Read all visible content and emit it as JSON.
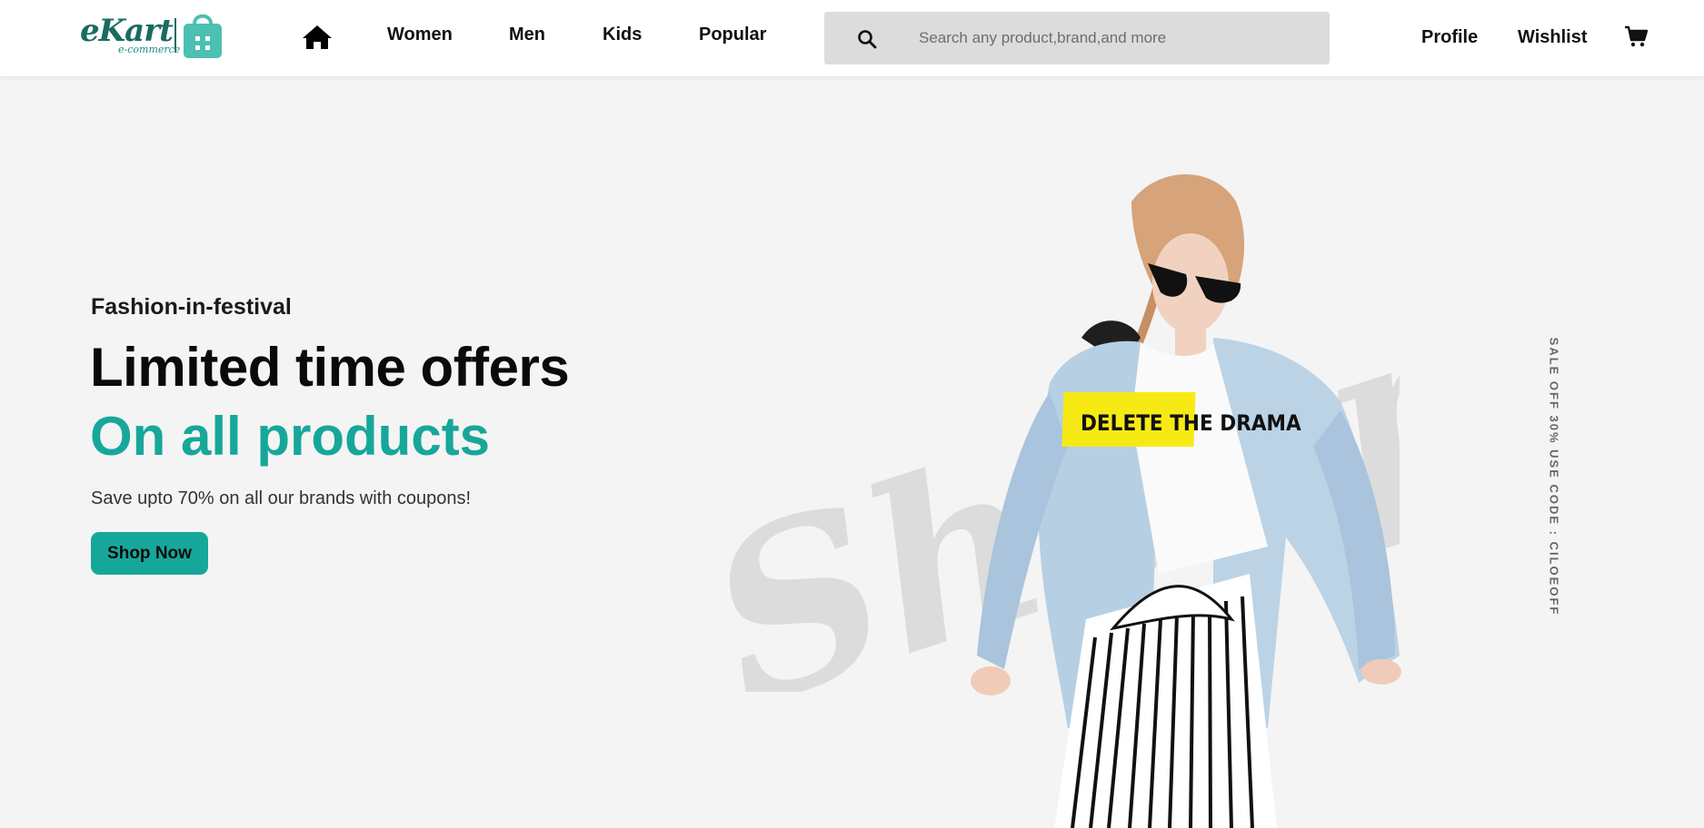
{
  "brand": {
    "name": "eKart",
    "tagline": "e-commerce",
    "accent_color": "#17a79a",
    "dark_color": "#1a6b62"
  },
  "nav": {
    "home_icon": "home-icon",
    "links": [
      "Women",
      "Men",
      "Kids",
      "Popular"
    ],
    "search_placeholder": "Search any product,brand,and more",
    "search_icon": "search-icon",
    "profile_label": "Profile",
    "wishlist_label": "Wishlist",
    "cart_icon": "cart-icon"
  },
  "hero": {
    "tagline": "Fashion-in-festival",
    "headline": "Limited time offers",
    "headline_accent": "On all products",
    "subtext": "Save upto 70% on all our brands with coupons!",
    "cta_label": "Shop Now",
    "watermark_text": "Shopping",
    "promo_code": "SALE OFF 30% USE CODE : CILOEOFF",
    "model_shirt_text": "DELETE THE DRAMA",
    "background_color": "#f4f4f4"
  }
}
